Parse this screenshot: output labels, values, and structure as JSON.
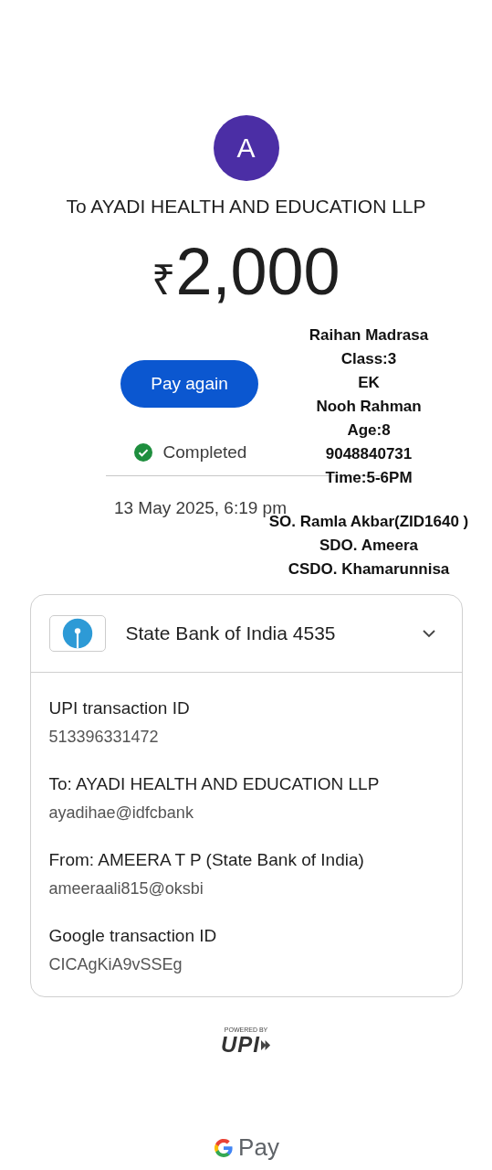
{
  "payee": {
    "avatar_letter": "A",
    "title": "To AYADI HEALTH AND EDUCATION LLP"
  },
  "amount": {
    "currency": "₹",
    "value": "2,000"
  },
  "pay_again": "Pay again",
  "status": {
    "label": "Completed",
    "kind": "success"
  },
  "date": "13 May 2025, 6:19 pm",
  "account": {
    "name": "State Bank of India 4535",
    "expanded": false
  },
  "details": [
    {
      "label": "UPI transaction ID",
      "value": "513396331472"
    },
    {
      "label": "To: AYADI HEALTH AND EDUCATION LLP",
      "value": "ayadihae@idfcbank"
    },
    {
      "label": "From: AMEERA  T P (State Bank of India)",
      "value": "ameeraali815@oksbi"
    },
    {
      "label": "Google transaction ID",
      "value": "CICAgKiA9vSSEg"
    }
  ],
  "upi_badge": {
    "caption": "POWERED BY",
    "logo": "UPI"
  },
  "footer_brand": "Pay",
  "note": {
    "blocks": [
      [
        "Raihan Madrasa",
        "Class:3",
        "EK",
        "Nooh Rahman",
        "Age:8",
        "9048840731",
        "Time:5-6PM"
      ],
      [
        "SO. Ramla Akbar(ZID1640 )",
        "SDO. Ameera",
        "CSDO. Khamarunnisa"
      ]
    ]
  }
}
